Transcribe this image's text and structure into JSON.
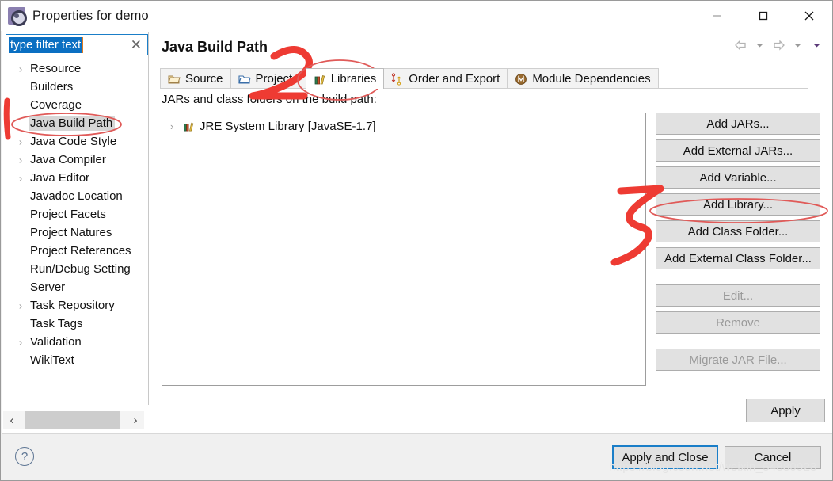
{
  "window": {
    "title": "Properties for demo",
    "icon": "properties-gear-icon",
    "minimize_label": "—",
    "maximize_label": "□",
    "close_label": "✕"
  },
  "sidebar": {
    "filter": {
      "value": "type filter text",
      "placeholder": "type filter text",
      "clear_label": "✕"
    },
    "items": [
      {
        "label": "Resource",
        "expandable": true,
        "selected": false
      },
      {
        "label": "Builders",
        "expandable": false,
        "selected": false
      },
      {
        "label": "Coverage",
        "expandable": false,
        "selected": false
      },
      {
        "label": "Java Build Path",
        "expandable": false,
        "selected": true
      },
      {
        "label": "Java Code Style",
        "expandable": true,
        "selected": false
      },
      {
        "label": "Java Compiler",
        "expandable": true,
        "selected": false
      },
      {
        "label": "Java Editor",
        "expandable": true,
        "selected": false
      },
      {
        "label": "Javadoc Location",
        "expandable": false,
        "selected": false
      },
      {
        "label": "Project Facets",
        "expandable": false,
        "selected": false
      },
      {
        "label": "Project Natures",
        "expandable": false,
        "selected": false
      },
      {
        "label": "Project References",
        "expandable": false,
        "selected": false
      },
      {
        "label": "Run/Debug Setting",
        "expandable": false,
        "selected": false
      },
      {
        "label": "Server",
        "expandable": false,
        "selected": false
      },
      {
        "label": "Task Repository",
        "expandable": true,
        "selected": false
      },
      {
        "label": "Task Tags",
        "expandable": false,
        "selected": false
      },
      {
        "label": "Validation",
        "expandable": true,
        "selected": false
      },
      {
        "label": "WikiText",
        "expandable": false,
        "selected": false
      }
    ],
    "scroll_left_label": "‹",
    "scroll_right_label": "›"
  },
  "page": {
    "title": "Java Build Path",
    "nav": {
      "back_icon": "back-arrow-icon",
      "back_menu_icon": "chevron-down-icon",
      "forward_icon": "forward-arrow-icon",
      "forward_menu_icon": "chevron-down-icon",
      "view_menu_icon": "view-menu-triangle-icon"
    },
    "tabs": [
      {
        "label": "Source",
        "icon": "source-folder-icon",
        "active": false
      },
      {
        "label": "Projects",
        "icon": "projects-icon",
        "active": false
      },
      {
        "label": "Libraries",
        "icon": "libraries-icon",
        "active": true
      },
      {
        "label": "Order and Export",
        "icon": "order-export-icon",
        "active": false
      },
      {
        "label": "Module Dependencies",
        "icon": "module-deps-icon",
        "active": false
      }
    ],
    "section_label": "JARs and class folders on the build path:",
    "list_rows": [
      {
        "label": "JRE System Library [JavaSE-1.7]",
        "icon": "libraries-icon",
        "expandable": true
      }
    ],
    "buttons": [
      {
        "label": "Add JARs...",
        "disabled": false,
        "gap": false
      },
      {
        "label": "Add External JARs...",
        "disabled": false,
        "gap": false
      },
      {
        "label": "Add Variable...",
        "disabled": false,
        "gap": false
      },
      {
        "label": "Add Library...",
        "disabled": false,
        "gap": false
      },
      {
        "label": "Add Class Folder...",
        "disabled": false,
        "gap": false
      },
      {
        "label": "Add External Class Folder...",
        "disabled": false,
        "gap": false
      },
      {
        "label": "Edit...",
        "disabled": true,
        "gap": true
      },
      {
        "label": "Remove",
        "disabled": true,
        "gap": false
      },
      {
        "label": "Migrate JAR File...",
        "disabled": true,
        "gap": true
      }
    ],
    "apply_label": "Apply"
  },
  "footer": {
    "help_label": "?",
    "apply_and_close_label": "Apply and Close",
    "cancel_label": "Cancel",
    "watermark": "https://blog.csdn.net/weixin_54880923"
  },
  "annotations": {
    "color": "#ee3b33",
    "ellipse_color": "#e05a58",
    "marks": [
      {
        "name": "step-1-stroke",
        "text": "1"
      },
      {
        "name": "step-2-stroke",
        "text": "2"
      },
      {
        "name": "step-3-stroke",
        "text": "3"
      }
    ]
  }
}
